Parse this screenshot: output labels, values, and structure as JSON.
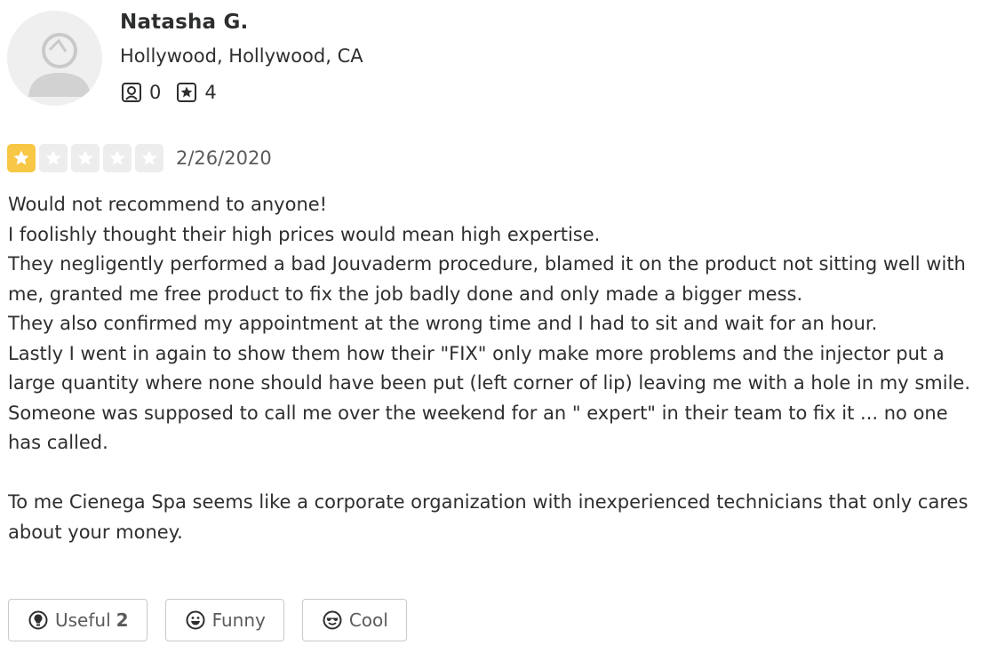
{
  "user": {
    "name": "Natasha G.",
    "location": "Hollywood, Hollywood, CA",
    "friends_count": "0",
    "reviews_count": "4",
    "friends_icon": "friends-icon",
    "reviews_icon": "review-star-icon"
  },
  "review": {
    "rating": 1,
    "max_rating": 5,
    "date": "2/26/2020",
    "star_color": "#f7c745",
    "empty_star_color": "#ededed",
    "lines": [
      "Would not recommend to anyone!",
      "I foolishly thought their high prices would mean high expertise.",
      "They negligently performed a bad Jouvaderm procedure, blamed it on the product not sitting well with me, granted me free product to fix the job badly done and only made a bigger mess.",
      "They also confirmed my appointment at the wrong time and I had to sit and wait for an hour.",
      "Lastly I went in again to show them how their \"FIX\" only make more problems and the injector put a large quantity where none should have been put (left corner of lip) leaving me with a hole in my smile.",
      "Someone was supposed to call me over the weekend for an \" expert\" in their team to fix it ... no one has called.",
      "",
      "To me Cienega Spa seems like a corporate organization with inexperienced technicians that only cares about your money."
    ]
  },
  "reactions": {
    "useful_label": "Useful",
    "useful_count": "2",
    "funny_label": "Funny",
    "cool_label": "Cool",
    "useful_icon": "lightbulb-icon",
    "funny_icon": "smiley-face-icon",
    "cool_icon": "sunglasses-face-icon"
  }
}
